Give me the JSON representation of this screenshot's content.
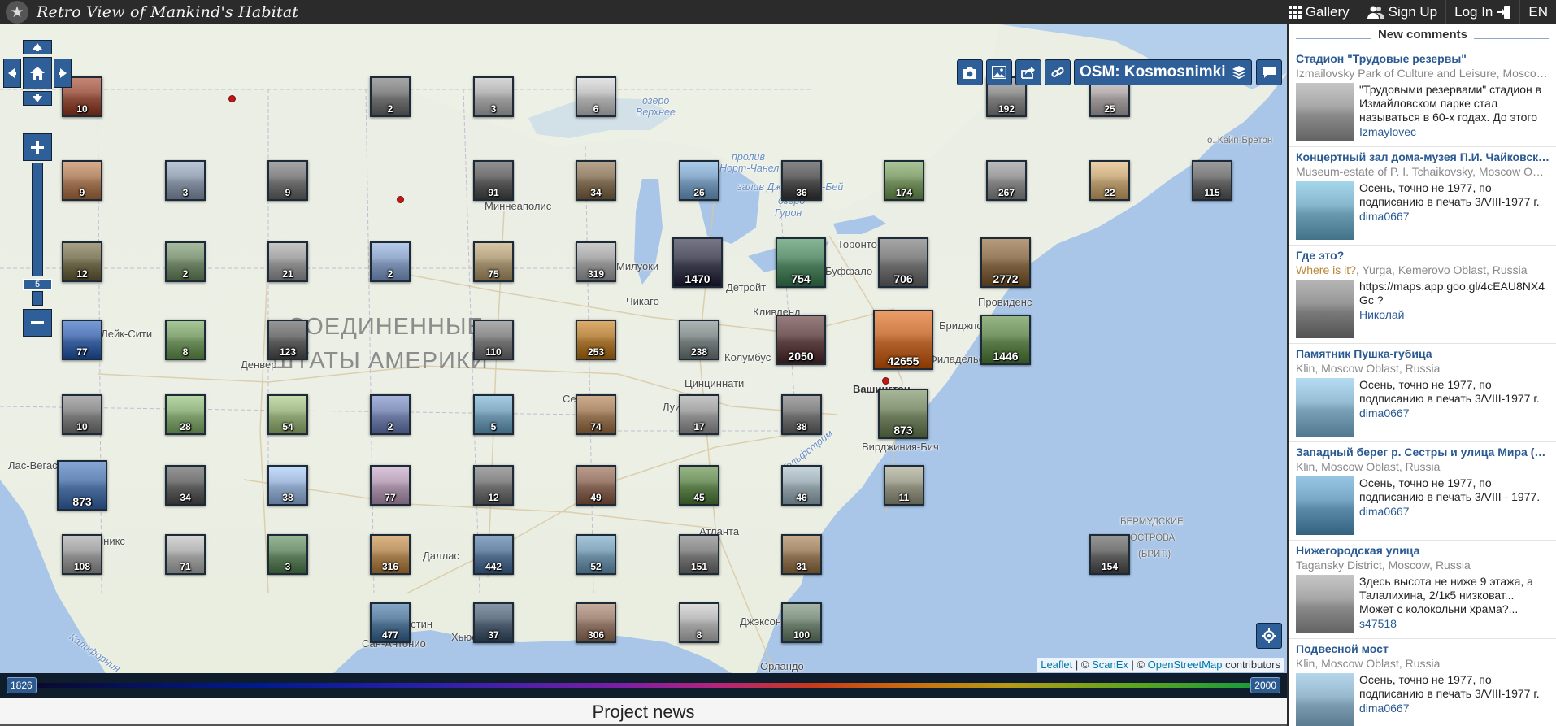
{
  "header": {
    "site_title": "Retro View of Mankind's Habitat",
    "nav": [
      {
        "label": "Gallery",
        "icon": "grid-icon"
      },
      {
        "label": "Sign Up",
        "icon": "users-icon"
      },
      {
        "label": "Log In",
        "icon": "login-icon"
      },
      {
        "label": "EN",
        "icon": ""
      }
    ]
  },
  "map": {
    "layer_label": "OSM: Kosmosnimki",
    "zoom_level": "5",
    "attribution": {
      "leaflet": "Leaflet",
      "sep1": " | © ",
      "scanex": "ScanEx",
      "sep2": " | © ",
      "osm": "OpenStreetMap",
      "suffix": " contributors"
    },
    "labels": [
      {
        "text": "СОЕДИНЕННЫЕ",
        "cls": "country"
      },
      {
        "text": "ШТАТЫ АМЕРИКИ",
        "cls": "country"
      },
      {
        "text": "озеро",
        "cls": "water"
      },
      {
        "text": "Верхнее",
        "cls": "water"
      },
      {
        "text": "пролив",
        "cls": "water"
      },
      {
        "text": "Норт-Чанел",
        "cls": "water"
      },
      {
        "text": "залив Джорджиан-Бей",
        "cls": "water"
      },
      {
        "text": "озеро",
        "cls": "water"
      },
      {
        "text": "Гурон",
        "cls": "water"
      },
      {
        "text": "Миннеаполис",
        "cls": ""
      },
      {
        "text": "Милуоки",
        "cls": ""
      },
      {
        "text": "Чикаго",
        "cls": ""
      },
      {
        "text": "Детройт",
        "cls": ""
      },
      {
        "text": "Торонто",
        "cls": ""
      },
      {
        "text": "Буффало",
        "cls": ""
      },
      {
        "text": "Провиденс",
        "cls": ""
      },
      {
        "text": "Бриджпорт",
        "cls": ""
      },
      {
        "text": "Кливленд",
        "cls": ""
      },
      {
        "text": "Колумбус",
        "cls": ""
      },
      {
        "text": "Цинциннати",
        "cls": ""
      },
      {
        "text": "Вашингтон",
        "cls": "bold"
      },
      {
        "text": "Филадельфия",
        "cls": ""
      },
      {
        "text": "Вирджиния-Бич",
        "cls": ""
      },
      {
        "text": "Сент-Луис",
        "cls": ""
      },
      {
        "text": "Луисвилл",
        "cls": ""
      },
      {
        "text": "Атланта",
        "cls": ""
      },
      {
        "text": "Даллас",
        "cls": ""
      },
      {
        "text": "Остин",
        "cls": ""
      },
      {
        "text": "Хьюстон",
        "cls": ""
      },
      {
        "text": "Сан-Антонио",
        "cls": ""
      },
      {
        "text": "Джэксонвилл",
        "cls": ""
      },
      {
        "text": "Орландо",
        "cls": ""
      },
      {
        "text": "Денвер",
        "cls": ""
      },
      {
        "text": "Солт-Лейк-Сити",
        "cls": ""
      },
      {
        "text": "Лас-Вегас",
        "cls": ""
      },
      {
        "text": "Финикс",
        "cls": ""
      },
      {
        "text": "БЕРМУДСКИЕ",
        "cls": "small"
      },
      {
        "text": "ОСТРОВА",
        "cls": "small"
      },
      {
        "text": "(БРИТ.)",
        "cls": "small"
      },
      {
        "text": "о. Кейп-Бретон",
        "cls": "small"
      },
      {
        "text": "Калифорния",
        "cls": "water"
      },
      {
        "text": "Гольфстрим",
        "cls": "water"
      }
    ],
    "clusters": [
      {
        "count": "10",
        "color": "#8a4a3a"
      },
      {
        "count": "2",
        "color": "#6b6b6b"
      },
      {
        "count": "3",
        "color": "#9a9a9a"
      },
      {
        "count": "6",
        "color": "#a8a8a8"
      },
      {
        "count": "192",
        "color": "#7a7a7a"
      },
      {
        "count": "25",
        "color": "#9b9494"
      },
      {
        "count": "9",
        "color": "#9a7050"
      },
      {
        "count": "3",
        "color": "#7f8a9a"
      },
      {
        "count": "9",
        "color": "#6a6a6a"
      },
      {
        "count": "91",
        "color": "#555"
      },
      {
        "count": "34",
        "color": "#7a6850"
      },
      {
        "count": "26",
        "color": "#7090b0"
      },
      {
        "count": "36",
        "color": "#4a4a4a"
      },
      {
        "count": "174",
        "color": "#6f8a5a"
      },
      {
        "count": "267",
        "color": "#808080"
      },
      {
        "count": "22",
        "color": "#b0956a"
      },
      {
        "count": "115",
        "color": "#606060"
      },
      {
        "count": "12",
        "color": "#6a6448"
      },
      {
        "count": "2",
        "color": "#6b7f63"
      },
      {
        "count": "21",
        "color": "#8a8a8a"
      },
      {
        "count": "2",
        "color": "#7a8fb0"
      },
      {
        "count": "75",
        "color": "#9a8a6a"
      },
      {
        "count": "319",
        "color": "#8f8f8f"
      },
      {
        "count": "1470",
        "color": "#3a3a4a"
      },
      {
        "count": "754",
        "color": "#4a7a5a"
      },
      {
        "count": "706",
        "color": "#6a6a6a"
      },
      {
        "count": "2772",
        "color": "#7a6040"
      },
      {
        "count": "77",
        "color": "#3b5f9a"
      },
      {
        "count": "8",
        "color": "#6a8a5a"
      },
      {
        "count": "123",
        "color": "#5a5a5a"
      },
      {
        "count": "110",
        "color": "#707070"
      },
      {
        "count": "253",
        "color": "#a07030"
      },
      {
        "count": "238",
        "color": "#707878"
      },
      {
        "count": "2050",
        "color": "#5a4040"
      },
      {
        "count": "42655",
        "color": "#b0602a"
      },
      {
        "count": "1446",
        "color": "#5a7a4a"
      },
      {
        "count": "10",
        "color": "#757575"
      },
      {
        "count": "28",
        "color": "#7a9a6a"
      },
      {
        "count": "54",
        "color": "#8aa070"
      },
      {
        "count": "2",
        "color": "#6a78a0"
      },
      {
        "count": "5",
        "color": "#6a90a8"
      },
      {
        "count": "74",
        "color": "#907050"
      },
      {
        "count": "17",
        "color": "#8a8a8a"
      },
      {
        "count": "38",
        "color": "#6a6a6a"
      },
      {
        "count": "873",
        "color": "#6a7a5a"
      },
      {
        "count": "873",
        "color": "#4a6a9a"
      },
      {
        "count": "34",
        "color": "#5a5a5a"
      },
      {
        "count": "38",
        "color": "#8aa0c0"
      },
      {
        "count": "77",
        "color": "#a08aa0"
      },
      {
        "count": "12",
        "color": "#6a6a6a"
      },
      {
        "count": "49",
        "color": "#806050"
      },
      {
        "count": "45",
        "color": "#5a7a4a"
      },
      {
        "count": "46",
        "color": "#8a9aa0"
      },
      {
        "count": "11",
        "color": "#8a8a7a"
      },
      {
        "count": "108",
        "color": "#8a8a8a"
      },
      {
        "count": "71",
        "color": "#9a9a9a"
      },
      {
        "count": "3",
        "color": "#5a7a5a"
      },
      {
        "count": "316",
        "color": "#a07a4a"
      },
      {
        "count": "442",
        "color": "#506a8a"
      },
      {
        "count": "52",
        "color": "#6a8aa0"
      },
      {
        "count": "151",
        "color": "#707070"
      },
      {
        "count": "31",
        "color": "#8a7050"
      },
      {
        "count": "154",
        "color": "#5a5a5a"
      },
      {
        "count": "477",
        "color": "#4a6a8a"
      },
      {
        "count": "37",
        "color": "#4a5a6a"
      },
      {
        "count": "306",
        "color": "#8a7060"
      },
      {
        "count": "8",
        "color": "#a0a0a0"
      },
      {
        "count": "100",
        "color": "#6a7a6a"
      }
    ]
  },
  "timeline": {
    "start_year": "1826",
    "end_year": "2000"
  },
  "footer": {
    "project_news": "Project news"
  },
  "comments": {
    "heading": "New comments",
    "items": [
      {
        "title": "Стадион \"Трудовые резервы\"",
        "place": "Izmailovsky Park of Culture and Leisure, Moscow, Russia",
        "place_prefix": "",
        "text": "\"Трудовыми резервами\" стадион в Измайловском парке стал называться в 60-х годах. До этого",
        "user": "Izmaylovec",
        "thumb": "#8a8a8a"
      },
      {
        "title": "Концертный зал дома-музея П.И. Чайковского",
        "place": "Museum-estate of P. I. Tchaikovsky, Moscow Oblast",
        "place_prefix": "",
        "text": "Осень, точно не 1977, по подписанию в печать 3/VIII-1977 г.",
        "user": "dima0667",
        "thumb": "#6a9ab0"
      },
      {
        "title": "Где это?",
        "place": ", Yurga, Kemerovo Oblast, Russia",
        "place_prefix": "Where is it?",
        "text": "https://maps.app.goo.gl/4cEAU8NX4Gc ?",
        "user": "Николай",
        "thumb": "#7a7a7a"
      },
      {
        "title": "Памятник Пушка-губица",
        "place": "Klin, Moscow Oblast, Russia",
        "place_prefix": "",
        "text": "Осень, точно не 1977, по подписанию в печать 3/VIII-1977 г.",
        "user": "dima0667",
        "thumb": "#7aa0b8"
      },
      {
        "title": "Западный берег р. Сестры и улица Мира (вид",
        "place": "Klin, Moscow Oblast, Russia",
        "place_prefix": "",
        "text": "Осень, точно не 1977, по подписанию в печать 3/VIII - 1977.",
        "user": "dima0667",
        "thumb": "#5a8aa8"
      },
      {
        "title": "Нижегородская улица",
        "place": "Tagansky District, Moscow, Russia",
        "place_prefix": "",
        "text": "Здесь высота не ниже 9 этажа, а Талалихина, 2/1к5 низковат... Может с колокольни храма?...",
        "user": "s47518",
        "thumb": "#8a8a8a"
      },
      {
        "title": "Подвесной мост",
        "place": "Klin, Moscow Oblast, Russia",
        "place_prefix": "",
        "text": "Осень, точно не 1977, по подписанию в печать 3/VIII-1977 г.",
        "user": "dima0667",
        "thumb": "#7a9ab0"
      }
    ]
  }
}
